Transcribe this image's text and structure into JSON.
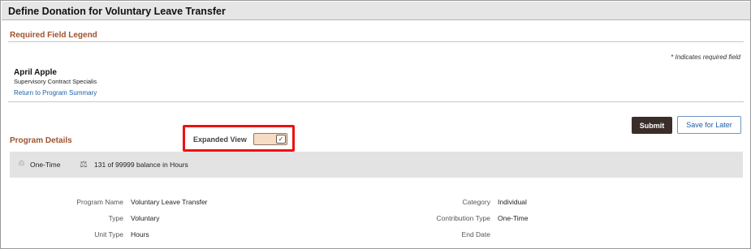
{
  "page": {
    "title": "Define Donation for Voluntary Leave Transfer"
  },
  "legend": {
    "header": "Required Field Legend",
    "note": "* Indicates required field"
  },
  "employee": {
    "name": "April Apple",
    "department": "Supervisory Contract Specialis",
    "return_link": "Return to Program Summary"
  },
  "actions": {
    "submit_label": "Submit",
    "save_label": "Save for Later"
  },
  "program_details": {
    "header": "Program Details",
    "expanded_view_label": "Expanded View",
    "expanded_view_on": true,
    "toggle_glyph": "✓"
  },
  "summary": {
    "frequency": "One-Time",
    "balance": "131 of 99999 balance in Hours",
    "frequency_icon": "♲",
    "balance_icon": "⚖"
  },
  "fields": {
    "program_name_label": "Program Name",
    "program_name_value": "Voluntary Leave Transfer",
    "type_label": "Type",
    "type_value": "Voluntary",
    "unit_type_label": "Unit Type",
    "unit_type_value": "Hours",
    "category_label": "Category",
    "category_value": "Individual",
    "contribution_type_label": "Contribution Type",
    "contribution_type_value": "One-Time",
    "end_date_label": "End Date",
    "end_date_value": ""
  },
  "colors": {
    "section_header": "#a0522d",
    "link": "#1f5fa8",
    "submit_bg": "#3a2d2a",
    "highlight": "#ee1111",
    "toggle_bg": "#f6dcc2"
  }
}
